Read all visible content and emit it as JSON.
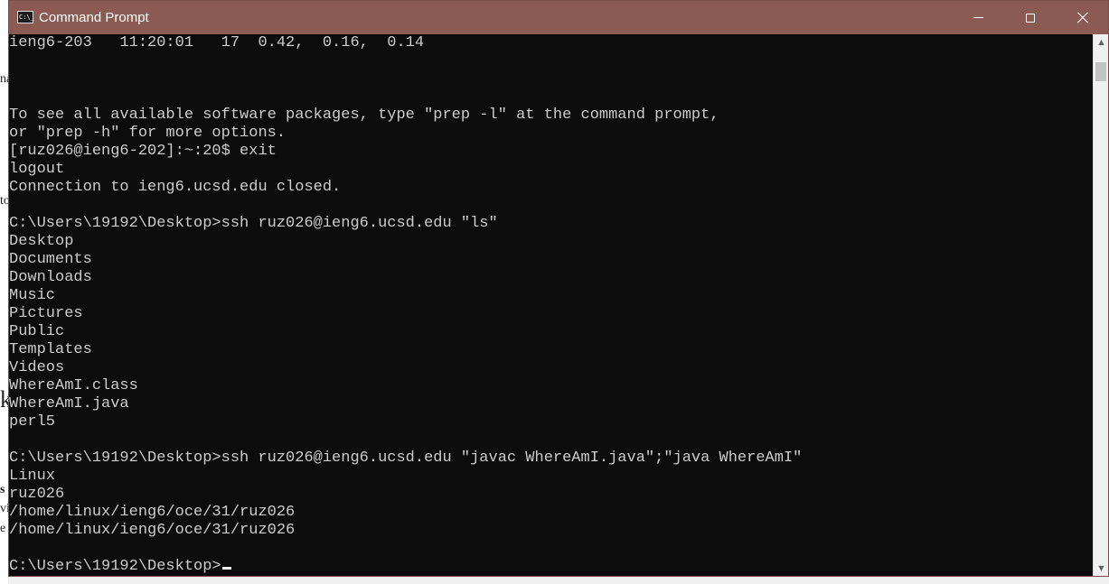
{
  "window": {
    "title": "Command Prompt",
    "icon": "cmd-icon",
    "icon_text": "C:\\_",
    "title_bar_color": "#8b5a52",
    "controls": {
      "minimize": "minimize-icon",
      "maximize": "maximize-icon",
      "close": "close-icon"
    }
  },
  "terminal": {
    "background": "#0c0c0c",
    "foreground": "#cccccc",
    "lines": [
      "ieng6-203   11:20:01   17  0.42,  0.16,  0.14",
      "",
      "",
      "",
      "To see all available software packages, type \"prep -l\" at the command prompt,",
      "or \"prep -h\" for more options.",
      "[ruz026@ieng6-202]:~:20$ exit",
      "logout",
      "Connection to ieng6.ucsd.edu closed.",
      "",
      "C:\\Users\\19192\\Desktop>ssh ruz026@ieng6.ucsd.edu \"ls\"",
      "Desktop",
      "Documents",
      "Downloads",
      "Music",
      "Pictures",
      "Public",
      "Templates",
      "Videos",
      "WhereAmI.class",
      "WhereAmI.java",
      "perl5",
      "",
      "C:\\Users\\19192\\Desktop>ssh ruz026@ieng6.ucsd.edu \"javac WhereAmI.java\";\"java WhereAmI\"",
      "Linux",
      "ruz026",
      "/home/linux/ieng6/oce/31/ruz026",
      "/home/linux/ieng6/oce/31/ruz026",
      "",
      "C:\\Users\\19192\\Desktop>"
    ]
  },
  "scrollbar": {
    "up_arrow": "▲",
    "down_arrow": "▼"
  }
}
